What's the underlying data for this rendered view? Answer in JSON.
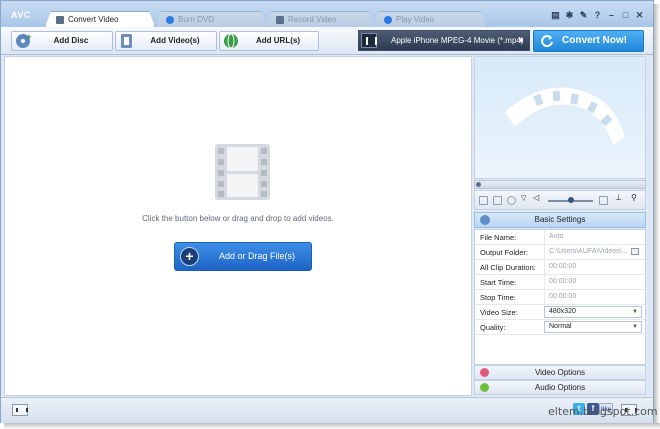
{
  "app": {
    "logo": "AVC"
  },
  "tabs": [
    {
      "label": "Convert Video",
      "active": true,
      "icon": "convert-video-icon"
    },
    {
      "label": "Burn DVD",
      "active": false,
      "icon": "burn-dvd-icon"
    },
    {
      "label": "Record Video",
      "active": false,
      "icon": "record-video-icon"
    },
    {
      "label": "Play Video",
      "active": false,
      "icon": "play-video-icon"
    }
  ],
  "window_controls": [
    "skin-icon",
    "settings-icon",
    "tools-icon",
    "help-icon",
    "minimize-icon",
    "maximize-icon",
    "close-icon"
  ],
  "toolbar": {
    "add_disc": "Add Disc",
    "add_videos": "Add Video(s)",
    "add_urls": "Add URL(s)",
    "profile": "Apple iPhone MPEG-4 Movie (*.mp4)",
    "convert_now": "Convert Now!"
  },
  "main": {
    "hint": "Click the button below or drag and drop to add videos.",
    "add_button": "Add or Drag File(s)"
  },
  "settings": {
    "header": "Basic Settings",
    "rows": [
      {
        "key": "File Name:",
        "value": "Auto"
      },
      {
        "key": "Output Folder:",
        "value": "C:\\Users\\AUFA\\Videos\\..."
      },
      {
        "key": "All Clip Duration:",
        "value": "00:00:00"
      },
      {
        "key": "Start Time:",
        "value": "00:00:00"
      },
      {
        "key": "Stop Time:",
        "value": "00:00:00"
      },
      {
        "key": "Video Size:",
        "value": "480x320"
      },
      {
        "key": "Quality:",
        "value": "Normal"
      }
    ]
  },
  "options": {
    "video": "Video Options",
    "audio": "Audio Options"
  },
  "watermark": "eltem.blogspot.com",
  "colors": {
    "accent": "#1f86d8",
    "frame": "#8aa6c8"
  }
}
